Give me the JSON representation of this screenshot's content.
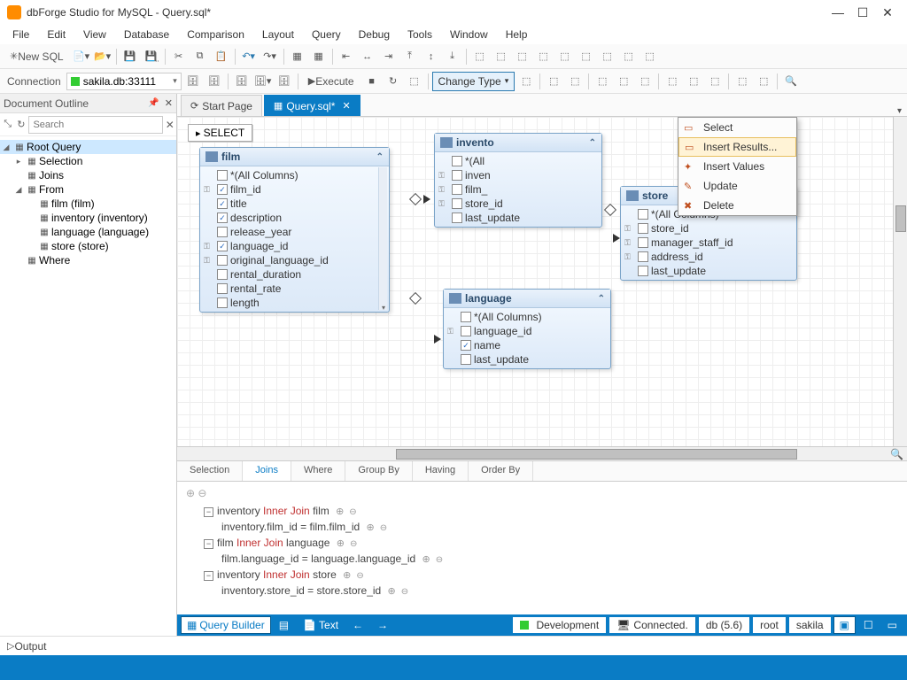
{
  "title": "dbForge Studio for MySQL - Query.sql*",
  "menu": [
    "File",
    "Edit",
    "View",
    "Database",
    "Comparison",
    "Layout",
    "Query",
    "Debug",
    "Tools",
    "Window",
    "Help"
  ],
  "toolbar1": {
    "newsql": "New SQL"
  },
  "toolbar2": {
    "conn_label": "Connection",
    "conn_value": "sakila.db:33111",
    "execute": "Execute",
    "change_type": "Change Type"
  },
  "dropdown": {
    "items": [
      "Select",
      "Insert Results...",
      "Insert Values",
      "Update",
      "Delete"
    ],
    "highlight": 1
  },
  "sidebar": {
    "title": "Document Outline",
    "search_placeholder": "Search",
    "tree": {
      "root": "Root Query",
      "selection": "Selection",
      "joins": "Joins",
      "from": "From",
      "from_items": [
        "film (film)",
        "inventory (inventory)",
        "language (language)",
        "store (store)"
      ],
      "where": "Where"
    }
  },
  "tabs": {
    "start": "Start Page",
    "query": "Query.sql*"
  },
  "select_badge": "SELECT",
  "tables": {
    "film": {
      "name": "film",
      "cols": [
        {
          "n": "*(All Columns)",
          "c": false,
          "k": ""
        },
        {
          "n": "film_id",
          "c": true,
          "k": "pk"
        },
        {
          "n": "title",
          "c": true,
          "k": ""
        },
        {
          "n": "description",
          "c": true,
          "k": ""
        },
        {
          "n": "release_year",
          "c": false,
          "k": ""
        },
        {
          "n": "language_id",
          "c": true,
          "k": "fk"
        },
        {
          "n": "original_language_id",
          "c": false,
          "k": "fk"
        },
        {
          "n": "rental_duration",
          "c": false,
          "k": ""
        },
        {
          "n": "rental_rate",
          "c": false,
          "k": ""
        },
        {
          "n": "length",
          "c": false,
          "k": ""
        }
      ]
    },
    "inventory": {
      "name": "invento",
      "cols": [
        {
          "n": "*(All",
          "c": false,
          "k": ""
        },
        {
          "n": "inven",
          "c": false,
          "k": "pk"
        },
        {
          "n": "film_",
          "c": false,
          "k": "fk"
        },
        {
          "n": "store_id",
          "c": false,
          "k": "fk"
        },
        {
          "n": "last_update",
          "c": false,
          "k": ""
        }
      ]
    },
    "language": {
      "name": "language",
      "cols": [
        {
          "n": "*(All Columns)",
          "c": false,
          "k": ""
        },
        {
          "n": "language_id",
          "c": false,
          "k": "pk"
        },
        {
          "n": "name",
          "c": true,
          "k": ""
        },
        {
          "n": "last_update",
          "c": false,
          "k": ""
        }
      ]
    },
    "store": {
      "name": "store",
      "cols": [
        {
          "n": "*(All Columns)",
          "c": false,
          "k": ""
        },
        {
          "n": "store_id",
          "c": false,
          "k": "pk"
        },
        {
          "n": "manager_staff_id",
          "c": false,
          "k": "fk"
        },
        {
          "n": "address_id",
          "c": false,
          "k": "fk"
        },
        {
          "n": "last_update",
          "c": false,
          "k": ""
        }
      ]
    }
  },
  "qtabs": [
    "Selection",
    "Joins",
    "Where",
    "Group By",
    "Having",
    "Order By"
  ],
  "qtab_active": 1,
  "joins": [
    {
      "l": "inventory",
      "r": "film",
      "on": "inventory.film_id = film.film_id"
    },
    {
      "l": "film",
      "r": "language",
      "on": "film.language_id = language.language_id"
    },
    {
      "l": "inventory",
      "r": "store",
      "on": "inventory.store_id = store.store_id"
    }
  ],
  "join_kw": "Inner Join",
  "viewbar": {
    "qb": "Query Builder",
    "text": "Text"
  },
  "status": {
    "env": "Development",
    "conn": "Connected.",
    "db": "db (5.6)",
    "user": "root",
    "schema": "sakila"
  },
  "output": "Output"
}
